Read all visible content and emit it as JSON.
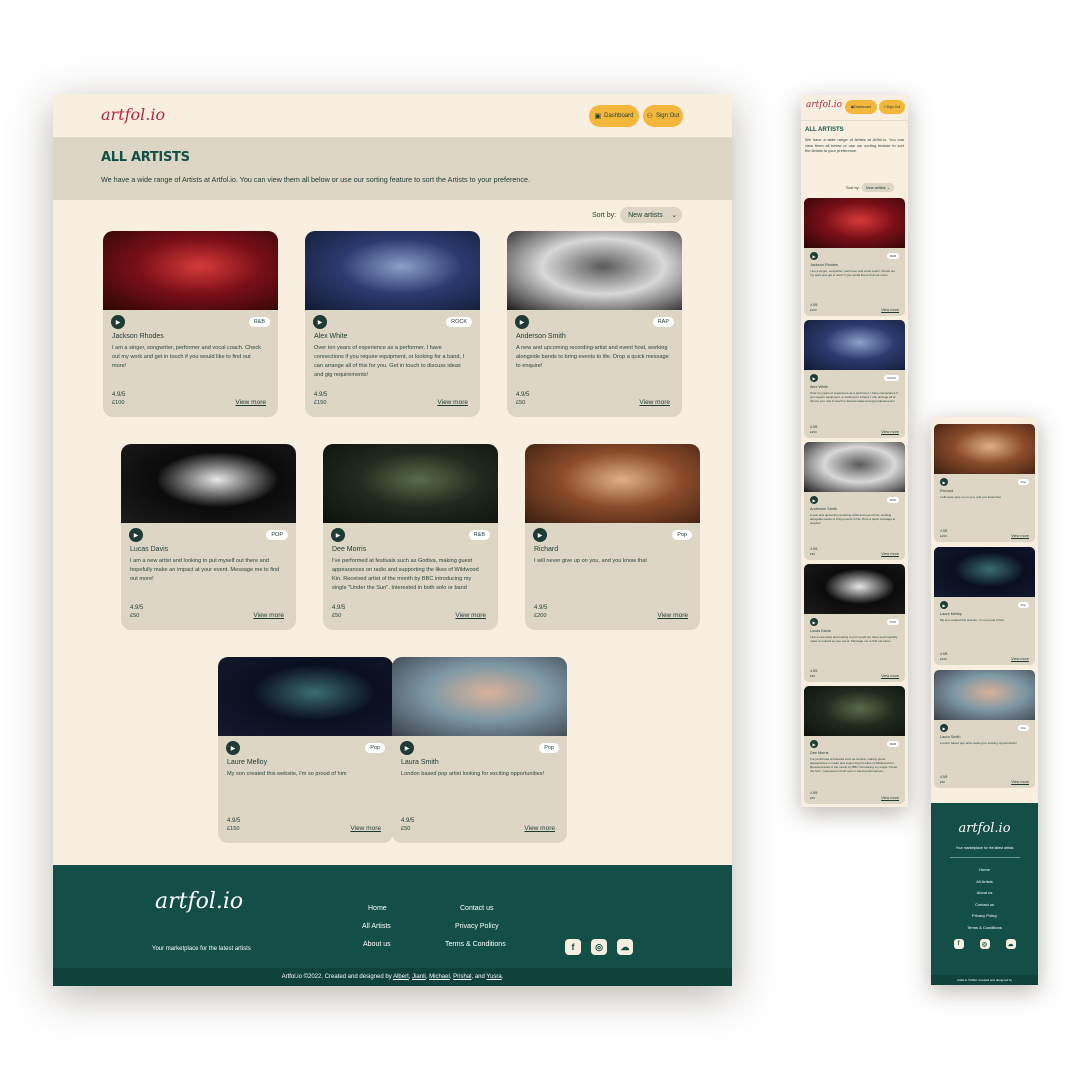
{
  "brand": {
    "logo_text": "artfol.io",
    "accent": "#b32a3c",
    "primary": "#134f47",
    "cream": "#f8efe0",
    "sand": "#ddd6c5",
    "yellow": "#f3b73c"
  },
  "header": {
    "dashboard_label": "Dashboard",
    "signout_label": "Sign Out"
  },
  "hero": {
    "title": "ALL ARTISTS",
    "text": "We have a wide range of Artists at Artfol.io. You can view them all below or use our sorting feature to sort the Artists to your preference."
  },
  "sort": {
    "label": "Sort by:",
    "selected": "New artists"
  },
  "view_more_label": "View more",
  "artists": [
    {
      "name": "Jackson Rhodes",
      "genre": "R&B",
      "rating": "4.9/5",
      "price": "£100",
      "desc": "I am a singer, songwriter, performer and vocal coach. Check out my work and get in touch if you would like to find out more!",
      "img_colors": [
        "#7a0f17",
        "#d63a3a",
        "#2a0606"
      ]
    },
    {
      "name": "Alex White",
      "genre": "ROCK",
      "rating": "4.9/5",
      "price": "£150",
      "desc": "Over ten years of experience as a performer. I have connections if you require equipment, or looking for a band, I can arrange all of this for you. Get in touch to discuss ideas and gig requirements!",
      "img_colors": [
        "#2b3a6e",
        "#8ba0c8",
        "#121a33"
      ]
    },
    {
      "name": "Anderson Smith",
      "genre": "RAP",
      "rating": "4.9/5",
      "price": "£50",
      "desc": "A new and upcoming recording-artist and event host, working alongside bands to bring events to life. Drop a quick message to enquire!",
      "img_colors": [
        "#d8d8d8",
        "#5a5a5a",
        "#1a1a1a"
      ]
    },
    {
      "name": "Lucas Davis",
      "genre": "POP",
      "rating": "4.9/5",
      "price": "£50",
      "desc": "I am a new artist and looking to put myself out there and hopefully make an impact at your event. Message me to find out more!",
      "img_colors": [
        "#0b0b0b",
        "#e8e8e8",
        "#1c1c1c"
      ]
    },
    {
      "name": "Dee Morris",
      "genre": "R&B",
      "rating": "4.9/5",
      "price": "£50",
      "desc": "I've performed at festivals such as Godiva, making guest appearances on radio and supporting the likes of Wildwood Kin. Received artist of the month by BBC introducing my single \"Under the Sun\". Interested in both solo or band performances.",
      "img_colors": [
        "#1f2a1d",
        "#5a6b4a",
        "#0c100b"
      ]
    },
    {
      "name": "Richard",
      "genre": "Pop",
      "rating": "4.9/5",
      "price": "£200",
      "desc": "I will never give up on you, and you know that",
      "img_colors": [
        "#8a4a2a",
        "#e0b08a",
        "#3a1e10"
      ]
    },
    {
      "name": "Laure Melloy",
      "genre": "Pop",
      "rating": "4.9/5",
      "price": "£150",
      "desc": "My son created this website, I'm so proud of him",
      "img_colors": [
        "#0a0f1e",
        "#3a6d70",
        "#141a30"
      ]
    },
    {
      "name": "Laura Smith",
      "genre": "Pop",
      "rating": "4.9/5",
      "price": "£50",
      "desc": "London based pop artist looking for exciting opportunities!",
      "img_colors": [
        "#7d98a5",
        "#d9b29a",
        "#3a3f48"
      ]
    }
  ],
  "footer": {
    "tagline": "Your marketplace for the latest artists",
    "links": [
      "Home",
      "All Artists",
      "About us",
      "Contact us",
      "Privacy Policy",
      "Terms & Conditions"
    ],
    "social_icons": [
      "facebook-icon",
      "instagram-icon",
      "soundcloud-icon"
    ],
    "copyright_prefix": "Artfol.io ©2022. Created and designed by ",
    "authors": [
      "Albert",
      "Jianli",
      "Michael",
      "Prishal",
      "Yusra"
    ],
    "mobile_copyright": "Artfol.io ©2022. Created and designed by"
  }
}
